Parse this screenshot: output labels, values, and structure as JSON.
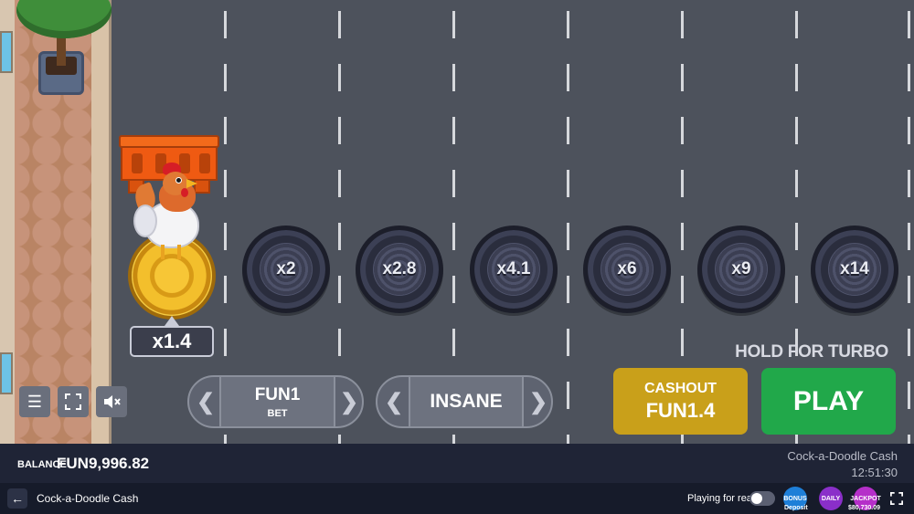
{
  "game": {
    "current_multiplier": "x1.4",
    "multipliers": [
      "x2",
      "x2.8",
      "x4.1",
      "x6",
      "x9",
      "x14"
    ]
  },
  "controls": {
    "bet_value": "FUN1",
    "bet_label": "BET",
    "difficulty": "INSANE",
    "hold_hint": "HOLD FOR TURBO",
    "cashout_label": "CASHOUT",
    "cashout_value": "FUN1.4",
    "play_label": "PLAY"
  },
  "balance_bar": {
    "label": "BALANCE",
    "value": "FUN9,996.82",
    "game_name": "Cock-a-Doodle Cash",
    "time": "12:51:30"
  },
  "footer": {
    "title": "Cock-a-Doodle Cash",
    "playing_for_real": "Playing for real",
    "promos": [
      {
        "label": "BONUS",
        "caption": "Deposit",
        "color": "#1e7fd8"
      },
      {
        "label": "DAILY",
        "caption": "",
        "color": "#8a2fc9"
      },
      {
        "label": "JACKPOT",
        "caption": "$80,730.09",
        "color": "#b52fc9"
      }
    ]
  },
  "icons": [
    "menu-icon",
    "fullscreen-icon",
    "mute-icon",
    "back-arrow-icon",
    "chevron-left-icon",
    "chevron-right-icon"
  ]
}
